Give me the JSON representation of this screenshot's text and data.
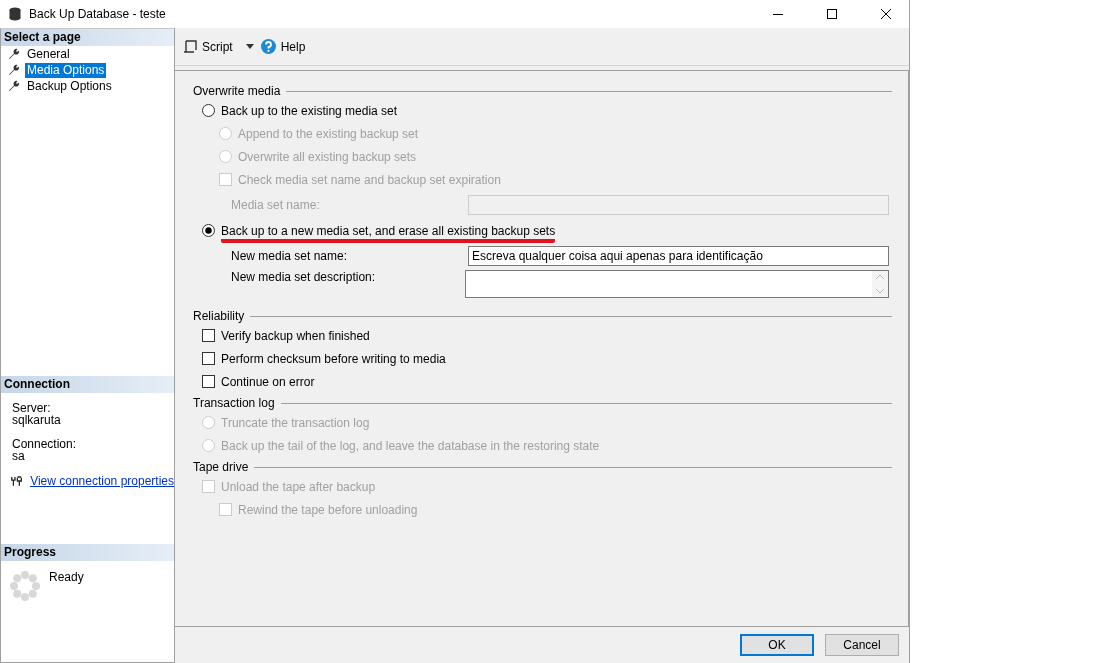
{
  "window": {
    "title": "Back Up Database - teste"
  },
  "sidebar": {
    "header": "Select a page",
    "pages": [
      {
        "label": "General",
        "selected": false
      },
      {
        "label": "Media Options",
        "selected": true
      },
      {
        "label": "Backup Options",
        "selected": false
      }
    ],
    "connection": {
      "header": "Connection",
      "server_label": "Server:",
      "server": "sqlkaruta",
      "connection_label": "Connection:",
      "connection": "sa",
      "link": "View connection properties"
    },
    "progress": {
      "header": "Progress",
      "status": "Ready"
    }
  },
  "toolbar": {
    "script": "Script",
    "help": "Help"
  },
  "sections": [
    {
      "title": "Overwrite media",
      "items": [
        {
          "kind": "radio",
          "label": "Back up to the existing media set",
          "selected": false,
          "disabled": false,
          "highlighted": false,
          "children": [
            {
              "kind": "radio",
              "label": "Append to the existing backup set",
              "selected": false,
              "disabled": true
            },
            {
              "kind": "radio",
              "label": "Overwrite all existing backup sets",
              "selected": false,
              "disabled": true
            },
            {
              "kind": "checkbox",
              "label": "Check media set name and backup set expiration",
              "checked": false,
              "disabled": true
            },
            {
              "kind": "field",
              "label": "Media set name:",
              "disabled": true
            }
          ]
        },
        {
          "kind": "radio",
          "label": "Back up to a new media set, and erase all existing backup sets",
          "selected": true,
          "disabled": false,
          "highlighted": true,
          "children": [
            {
              "kind": "field",
              "label": "New media set name:",
              "value": "Escreva qualquer coisa aqui apenas para identificação",
              "disabled": false
            },
            {
              "kind": "textarea",
              "label": "New media set description:"
            }
          ]
        }
      ]
    },
    {
      "title": "Reliability",
      "items": [
        {
          "kind": "checkbox",
          "label": "Verify backup when finished",
          "checked": false,
          "disabled": false
        },
        {
          "kind": "checkbox",
          "label": "Perform checksum before writing to media",
          "checked": false,
          "disabled": false
        },
        {
          "kind": "checkbox",
          "label": "Continue on error",
          "checked": false,
          "disabled": false
        }
      ]
    },
    {
      "title": "Transaction log",
      "items": [
        {
          "kind": "radio",
          "label": "Truncate the transaction log",
          "selected": false,
          "disabled": true
        },
        {
          "kind": "radio",
          "label": "Back up the tail of the log, and leave the database in the restoring state",
          "selected": false,
          "disabled": true
        }
      ]
    },
    {
      "title": "Tape drive",
      "items": [
        {
          "kind": "checkbox",
          "label": "Unload the tape after backup",
          "checked": false,
          "disabled": true,
          "children": [
            {
              "kind": "checkbox",
              "label": "Rewind the tape before unloading",
              "checked": false,
              "disabled": true
            }
          ]
        }
      ]
    }
  ],
  "buttons": [
    "OK",
    "Cancel"
  ]
}
